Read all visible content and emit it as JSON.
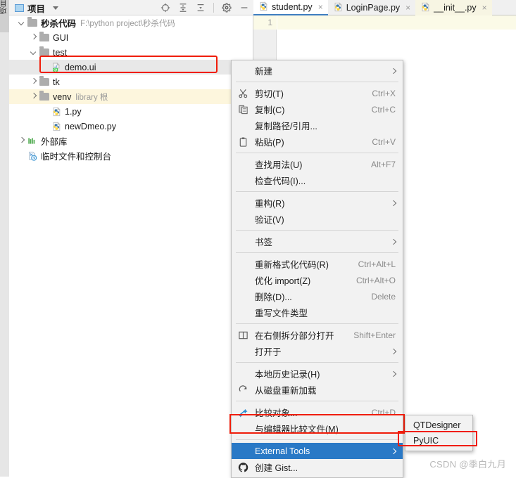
{
  "left_strip": {
    "project_tab_label": "项目"
  },
  "project_panel": {
    "header": {
      "icon": "project-window-icon",
      "title": "项目",
      "dropdown_icon": "chevron-down-icon",
      "actions": [
        {
          "name": "locate-icon",
          "tooltip": "选择打开的文件"
        },
        {
          "name": "expand-all-icon",
          "tooltip": "全部展开"
        },
        {
          "name": "collapse-all-icon",
          "tooltip": "全部折叠"
        },
        {
          "name": "gear-icon",
          "tooltip": "设置"
        },
        {
          "name": "minimize-icon",
          "tooltip": "隐藏"
        }
      ]
    },
    "tree": [
      {
        "id": "root",
        "label": "秒杀代码",
        "suffix": "F:\\python project\\秒杀代码",
        "indent": 0,
        "arrow": "down",
        "icon": "folder-icon",
        "bold": true,
        "highlight": "none"
      },
      {
        "id": "gui",
        "label": "GUI",
        "suffix": "",
        "indent": 1,
        "arrow": "right",
        "icon": "folder-icon",
        "bold": false,
        "highlight": "none"
      },
      {
        "id": "test",
        "label": "test",
        "suffix": "",
        "indent": 1,
        "arrow": "down",
        "icon": "folder-icon",
        "bold": false,
        "highlight": "none"
      },
      {
        "id": "demo-ui",
        "label": "demo.ui",
        "suffix": "",
        "indent": 2,
        "arrow": "none",
        "icon": "qt-ui-file-icon",
        "bold": false,
        "highlight": "selected"
      },
      {
        "id": "tk",
        "label": "tk",
        "suffix": "",
        "indent": 1,
        "arrow": "right",
        "icon": "folder-icon",
        "bold": false,
        "highlight": "none"
      },
      {
        "id": "venv",
        "label": "venv",
        "suffix": "library 根",
        "indent": 1,
        "arrow": "right",
        "icon": "folder-icon",
        "bold": false,
        "highlight": "yellow"
      },
      {
        "id": "1-py",
        "label": "1.py",
        "suffix": "",
        "indent": 2,
        "arrow": "none",
        "icon": "python-file-icon",
        "bold": false,
        "highlight": "none"
      },
      {
        "id": "newdmeo-py",
        "label": "newDmeo.py",
        "suffix": "",
        "indent": 2,
        "arrow": "none",
        "icon": "python-file-icon",
        "bold": false,
        "highlight": "none"
      },
      {
        "id": "external-libs",
        "label": "外部库",
        "suffix": "",
        "indent": 0,
        "arrow": "right",
        "icon": "external-library-icon",
        "bold": false,
        "highlight": "none"
      },
      {
        "id": "scratches",
        "label": "临时文件和控制台",
        "suffix": "",
        "indent": 0,
        "arrow": "none",
        "icon": "scratches-icon",
        "bold": false,
        "highlight": "none"
      }
    ]
  },
  "editor": {
    "tabs": [
      {
        "label": "student.py",
        "icon": "python-file-icon",
        "state": "active",
        "close_icon": "×"
      },
      {
        "label": "LoginPage.py",
        "icon": "python-file-icon",
        "state": "inactive",
        "close_icon": "×"
      },
      {
        "label": "__init__.py",
        "icon": "python-file-icon",
        "state": "tinted",
        "close_icon": "×"
      }
    ],
    "line_number": "1"
  },
  "context_menu": {
    "items": [
      {
        "type": "item",
        "label": "新建",
        "shortcut": "",
        "icon": "",
        "submenu": true
      },
      {
        "type": "separator"
      },
      {
        "type": "item",
        "label": "剪切(T)",
        "shortcut": "Ctrl+X",
        "icon": "scissors-icon",
        "submenu": false
      },
      {
        "type": "item",
        "label": "复制(C)",
        "shortcut": "Ctrl+C",
        "icon": "copy-icon",
        "submenu": false
      },
      {
        "type": "item",
        "label": "复制路径/引用...",
        "shortcut": "",
        "icon": "",
        "submenu": false
      },
      {
        "type": "item",
        "label": "粘贴(P)",
        "shortcut": "Ctrl+V",
        "icon": "clipboard-icon",
        "submenu": false
      },
      {
        "type": "separator"
      },
      {
        "type": "item",
        "label": "查找用法(U)",
        "shortcut": "Alt+F7",
        "icon": "",
        "submenu": false
      },
      {
        "type": "item",
        "label": "检查代码(I)...",
        "shortcut": "",
        "icon": "",
        "submenu": false
      },
      {
        "type": "separator"
      },
      {
        "type": "item",
        "label": "重构(R)",
        "shortcut": "",
        "icon": "",
        "submenu": true
      },
      {
        "type": "item",
        "label": "验证(V)",
        "shortcut": "",
        "icon": "",
        "submenu": false
      },
      {
        "type": "separator"
      },
      {
        "type": "item",
        "label": "书签",
        "shortcut": "",
        "icon": "",
        "submenu": true
      },
      {
        "type": "separator"
      },
      {
        "type": "item",
        "label": "重新格式化代码(R)",
        "shortcut": "Ctrl+Alt+L",
        "icon": "",
        "submenu": false
      },
      {
        "type": "item",
        "label": "优化 import(Z)",
        "shortcut": "Ctrl+Alt+O",
        "icon": "",
        "submenu": false
      },
      {
        "type": "item",
        "label": "删除(D)...",
        "shortcut": "Delete",
        "icon": "",
        "submenu": false
      },
      {
        "type": "item",
        "label": "重写文件类型",
        "shortcut": "",
        "icon": "",
        "submenu": false
      },
      {
        "type": "separator"
      },
      {
        "type": "item",
        "label": "在右侧拆分部分打开",
        "shortcut": "Shift+Enter",
        "icon": "split-window-icon",
        "submenu": false
      },
      {
        "type": "item",
        "label": "打开于",
        "shortcut": "",
        "icon": "",
        "submenu": true
      },
      {
        "type": "separator"
      },
      {
        "type": "item",
        "label": "本地历史记录(H)",
        "shortcut": "",
        "icon": "",
        "submenu": true
      },
      {
        "type": "item",
        "label": "从磁盘重新加载",
        "shortcut": "",
        "icon": "refresh-icon",
        "submenu": false
      },
      {
        "type": "separator"
      },
      {
        "type": "item",
        "label": "比较对象...",
        "shortcut": "Ctrl+D",
        "icon": "compare-icon",
        "submenu": false
      },
      {
        "type": "item",
        "label": "与编辑器比较文件(M)",
        "shortcut": "",
        "icon": "",
        "submenu": false
      },
      {
        "type": "separator"
      },
      {
        "type": "item",
        "label": "External Tools",
        "shortcut": "",
        "icon": "",
        "submenu": true,
        "selected": true
      },
      {
        "type": "item",
        "label": "创建 Gist...",
        "shortcut": "",
        "icon": "github-icon",
        "submenu": false
      }
    ]
  },
  "submenu": {
    "items": [
      {
        "label": "QTDesigner",
        "highlight": "none"
      },
      {
        "label": "PyUIC",
        "highlight": "callout"
      }
    ]
  },
  "callouts": {
    "color": "#f01d0a",
    "targets": [
      "demo.ui",
      "External Tools",
      "PyUIC"
    ]
  },
  "watermark": {
    "text": "CSDN @季白九月"
  }
}
